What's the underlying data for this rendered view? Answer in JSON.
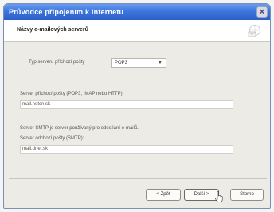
{
  "window": {
    "title": "Průvodce připojením k Internetu",
    "close_glyph": "✕"
  },
  "header": {
    "title": "Názvy e-mailových serverů",
    "icon": "envelope-globe-icon"
  },
  "form": {
    "server_type_label": "Typ serveru příchozí pošty",
    "server_type_value": "POP3",
    "incoming_label": "Server příchozí pošty (POP3, IMAP nebo HTTP):",
    "incoming_value": "mail.netcn.sk",
    "smtp_note": "Server SMTP je server používaný pro odesílání e-mailů.",
    "outgoing_label": "Server odchozí pošty (SMTP):",
    "outgoing_value": "mail.dnet.sk"
  },
  "buttons": {
    "back": "< Zpět",
    "next": "Další >",
    "cancel": "Storno"
  }
}
